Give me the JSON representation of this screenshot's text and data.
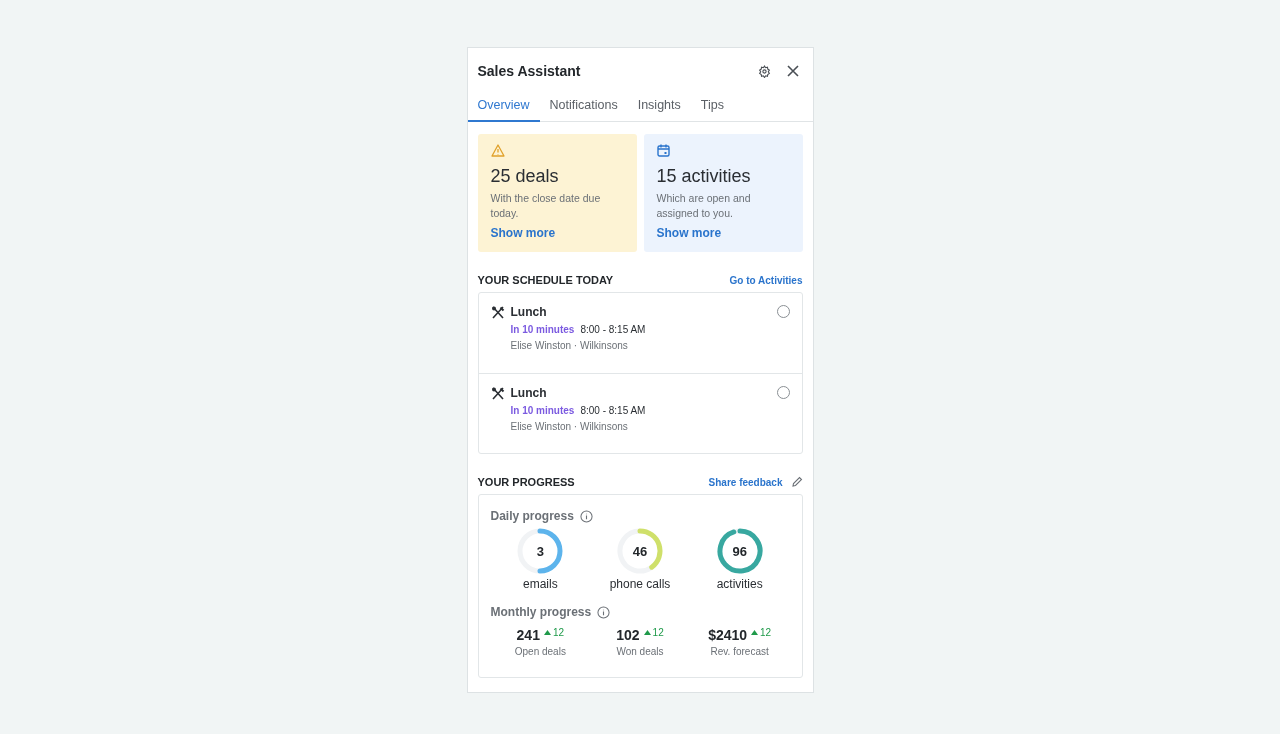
{
  "window": {
    "title": "Sales Assistant"
  },
  "tabs": [
    {
      "label": "Overview",
      "selected": true
    },
    {
      "label": "Notifications",
      "selected": false
    },
    {
      "label": "Insights",
      "selected": false
    },
    {
      "label": "Tips",
      "selected": false
    }
  ],
  "summary_cards": [
    {
      "kind": "warning",
      "count": "25 deals",
      "description": "With the close date due today.",
      "link": "Show more"
    },
    {
      "kind": "calendar",
      "count": "15 activities",
      "description": "Which are open and assigned to you.",
      "link": "Show more"
    }
  ],
  "schedule": {
    "heading": "YOUR SCHEDULE TODAY",
    "link": "Go to Activities",
    "items": [
      {
        "title": "Lunch",
        "due": "In 10 minutes",
        "time": "8:00 - 8:15 AM",
        "people": "Elise Winston · Wilkinsons",
        "checked": false
      },
      {
        "title": "Lunch",
        "due": "In 10 minutes",
        "time": "8:00 - 8:15 AM",
        "people": "Elise Winston · Wilkinsons",
        "checked": false
      }
    ]
  },
  "progress": {
    "heading": "YOUR PROGRESS",
    "link": "Share feedback",
    "daily_title": "Daily progress",
    "daily": [
      {
        "value": "3",
        "label": "emails",
        "level": 0.5,
        "color": "#5db4ec"
      },
      {
        "value": "46",
        "label": "phone calls",
        "level": 0.4,
        "color": "#cfe06a"
      },
      {
        "value": "96",
        "label": "activities",
        "level": 0.95,
        "color": "#38a8a0"
      }
    ],
    "monthly_title": "Monthly progress",
    "monthly": [
      {
        "value": "241",
        "change": "12",
        "label": "Open deals"
      },
      {
        "value": "102",
        "change": "12",
        "label": "Won deals"
      },
      {
        "value": "$2410",
        "change": "12",
        "label": "Rev. forecast"
      }
    ]
  }
}
